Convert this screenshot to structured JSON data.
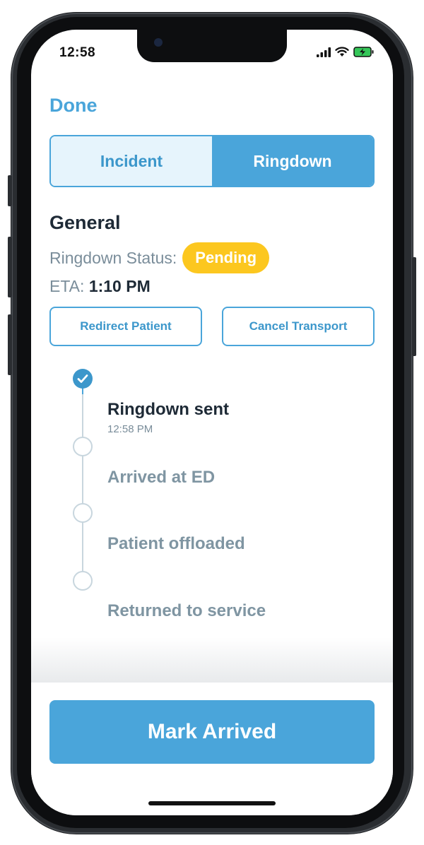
{
  "status_bar": {
    "time": "12:58",
    "icons": [
      "signal-icon",
      "wifi-icon",
      "battery-charging-icon"
    ]
  },
  "nav": {
    "done_label": "Done"
  },
  "tabs": [
    {
      "label": "Incident",
      "selected": false
    },
    {
      "label": "Ringdown",
      "selected": true
    }
  ],
  "general": {
    "title": "General",
    "status_label": "Ringdown Status:",
    "status_value": "Pending",
    "eta_label": "ETA:",
    "eta_value": "1:10 PM"
  },
  "actions": {
    "redirect_label": "Redirect Patient",
    "cancel_label": "Cancel Transport"
  },
  "timeline": [
    {
      "label": "Ringdown sent",
      "time": "12:58 PM",
      "done": true
    },
    {
      "label": "Arrived at ED",
      "done": false
    },
    {
      "label": "Patient offloaded",
      "done": false
    },
    {
      "label": "Returned to service",
      "done": false
    }
  ],
  "primary_action": {
    "label": "Mark Arrived"
  },
  "colors": {
    "accent": "#4aa5da",
    "pending": "#fcc71f",
    "text_dark": "#1e2a36",
    "text_muted": "#7a8d9a"
  }
}
